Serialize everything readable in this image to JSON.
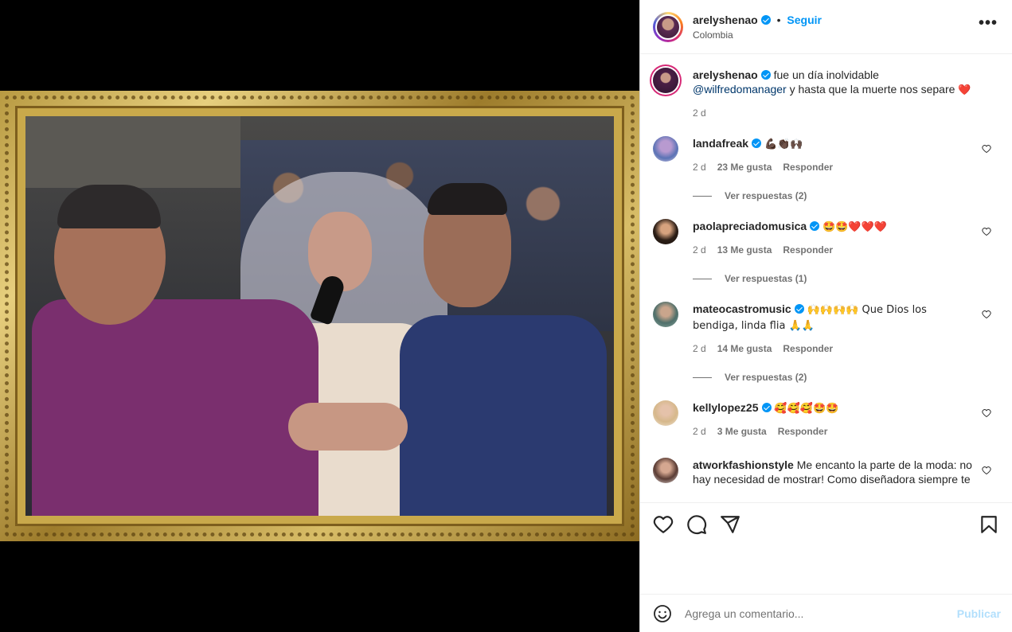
{
  "post": {
    "username": "arelyshenao",
    "follow_label": "Seguir",
    "dot": "•",
    "location": "Colombia",
    "more_label": "•••"
  },
  "caption": {
    "username": "arelyshenao",
    "text_before": "fue un día inolvidable ",
    "mention": "@wilfredomanager",
    "text_after": " y hasta que la muerte nos separe ",
    "emoji": "❤️",
    "time": "2 d"
  },
  "comments": [
    {
      "username": "landafreak",
      "text": "💪🏿👏🏿🙌🏿",
      "time": "2 d",
      "likes": "23 Me gusta",
      "reply": "Responder",
      "view_replies": "Ver respuestas (2)"
    },
    {
      "username": "paolapreciadomusica",
      "text": "🤩🤩❤️❤️❤️",
      "time": "2 d",
      "likes": "13 Me gusta",
      "reply": "Responder",
      "view_replies": "Ver respuestas (1)"
    },
    {
      "username": "mateocastromusic",
      "text": "🙌🙌🙌🙌 Que Dios los bendiga, linda flia 🙏🙏",
      "time": "2 d",
      "likes": "14 Me gusta",
      "reply": "Responder",
      "view_replies": "Ver respuestas (2)"
    },
    {
      "username": "kellylopez25",
      "text": "🥰🥰🥰🤩🤩",
      "time": "2 d",
      "likes": "3 Me gusta",
      "reply": "Responder"
    },
    {
      "username": "atworkfashionstyle",
      "text": "Me encanto la parte de la moda: no hay necesidad de mostrar! Como diseñadora siempre te"
    }
  ],
  "add_comment": {
    "placeholder": "Agrega un comentario...",
    "post_label": "Publicar"
  },
  "colors": {
    "accent": "#0095f6",
    "heart_red": "#ed4956",
    "post_disabled": "#b2dffc"
  }
}
